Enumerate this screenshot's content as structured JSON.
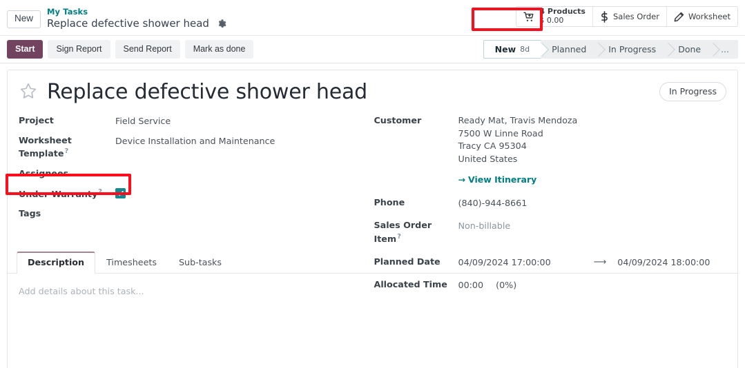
{
  "control_panel": {
    "new_button": "New",
    "breadcrumb_parent": "My Tasks",
    "breadcrumb_current": "Replace defective shower head",
    "gear_icon": "gear-icon",
    "smart_buttons": [
      {
        "icon": "cart-plus-icon",
        "line1": "4 Products",
        "line2": "$ 0.00"
      },
      {
        "icon": "dollar-icon",
        "label": "Sales Order"
      },
      {
        "icon": "pencil-icon",
        "label": "Worksheet"
      }
    ]
  },
  "action_bar": {
    "buttons": [
      {
        "label": "Start",
        "primary": true
      },
      {
        "label": "Sign Report",
        "primary": false
      },
      {
        "label": "Send Report",
        "primary": false
      },
      {
        "label": "Mark as done",
        "primary": false
      }
    ],
    "statuses": [
      {
        "label": "New",
        "duration": "8d",
        "active": true
      },
      {
        "label": "Planned",
        "duration": "",
        "active": false
      },
      {
        "label": "In Progress",
        "duration": "",
        "active": false
      },
      {
        "label": "Done",
        "duration": "",
        "active": false
      },
      {
        "label": "...",
        "duration": "",
        "active": false
      }
    ]
  },
  "record": {
    "star_icon": "star-outline-icon",
    "title": "Replace defective shower head",
    "kanban_state": "In Progress",
    "left_fields": [
      {
        "label": "Project",
        "value": "Field Service",
        "help": false
      },
      {
        "label": "Worksheet Template",
        "value": "Device Installation and Maintenance",
        "help": true
      },
      {
        "label": "Assignees",
        "value": "",
        "help": false
      },
      {
        "label": "Under Warranty",
        "value": "",
        "help": true,
        "checkbox": true,
        "checked": true
      },
      {
        "label": "Tags",
        "value": "",
        "help": false
      }
    ],
    "customer": {
      "label": "Customer",
      "name": "Ready Mat, Travis Mendoza",
      "street": "7500 W Linne Road",
      "city": "Tracy CA 95304",
      "country": "United States",
      "itinerary_link": "View Itinerary"
    },
    "right_fields": [
      {
        "label": "Phone",
        "value": "(840)-944-8661",
        "help": false
      },
      {
        "label": "Sales Order Item",
        "value": "Non-billable",
        "help": true,
        "muted": true
      },
      {
        "label": "Planned Date",
        "value": "04/09/2024 17:00:00",
        "value_end": "04/09/2024 18:00:00",
        "help": false
      },
      {
        "label": "Allocated Time",
        "value": "00:00",
        "value_extra": "(0%)",
        "help": false
      }
    ]
  },
  "notebook": {
    "tabs": [
      {
        "label": "Description",
        "active": true
      },
      {
        "label": "Timesheets",
        "active": false
      },
      {
        "label": "Sub-tasks",
        "active": false
      }
    ],
    "description_placeholder": "Add details about this task..."
  },
  "colors": {
    "accent_teal": "#017e84",
    "primary_button": "#71435f",
    "checkbox_teal": "#128a8f",
    "highlight_red": "#fc0d1c"
  }
}
